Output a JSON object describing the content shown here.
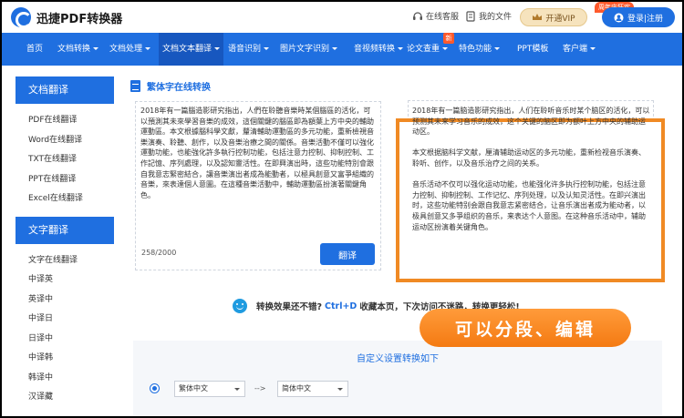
{
  "header": {
    "logo_text": "迅捷PDF转换器",
    "service_label": "在线客服",
    "files_label": "我的文件",
    "vip_label": "开通VIP",
    "vip_tag": "周年庆狂欢",
    "login_label": "登录|注册"
  },
  "nav": {
    "items": [
      "首页",
      "文档转换",
      "文档处理",
      "文档文本翻译",
      "语音识别",
      "图片文字识别",
      "音视频转换",
      "论文查重",
      "特色功能",
      "PPT模板",
      "客户端"
    ],
    "new_badge": "新"
  },
  "sidebar": {
    "section1_title": "文档翻译",
    "section1_items": [
      "PDF在线翻译",
      "Word在线翻译",
      "TXT在线翻译",
      "PPT在线翻译",
      "Excel在线翻译"
    ],
    "section2_title": "文字翻译",
    "section2_items": [
      "文字在线翻译",
      "中译英",
      "英译中",
      "中译日",
      "日译中",
      "中译韩",
      "韩译中",
      "汉译藏"
    ]
  },
  "main": {
    "title": "繁体字在线转换",
    "source_paragraphs": [
      "2018年有一篇腦造影研究指出，人們在聆聽音樂時某個腦區的活化，可以預測其未來學習音樂的成效，這個關鍵的腦區即為額葉上方中央的輔助運動區。本文根據腦科學文獻，釐清輔助運動區的多元功能，重新檢視音樂演奏、聆聽、創作，以及音樂治療之間的關係。音樂活動不僅可以強化運動功能，也能強化許多執行控制功能，包括注意力控制、抑制控制、工作記憶、序列處理，以及認知靈活性。在即興演出時，這些功能特別會跟自我意志緊密結合，讓音樂演出者成為能動者，以極具創意又富爭組織的音樂，來表達個人意圖。在這種音樂活動中，輔助運動區扮演著關鍵角色。"
    ],
    "counter": "258/2000",
    "translate_button": "翻译",
    "output_paragraphs": [
      "2018年有一篇脑造影研究指出，人们在聆听音乐时某个脑区的活化，可以预测其未来学习音乐的成效，这个关键的脑区即为额叶上方中央的辅助运动区。",
      "本文根据脑科学文献，厘清辅助运动区的多元功能，重新检视音乐演奏、聆听、创作，以及音乐治疗之间的关系。",
      "音乐活动不仅可以强化运动功能，也能强化许多执行控制功能，包括注意力控制、抑制控制、工作记忆、序列处理，以及认知灵活性。在即兴演出时，这些功能特别会跟自我意志紧密结合，让音乐演出者成为能动者，以极具创意又多爭组织的音乐，来表达个人意图。在这种音乐活动中，辅助运动区扮演着关键角色。"
    ],
    "tip_before": "转换效果还不错?",
    "tip_shortcut": "Ctrl+D",
    "tip_after": "收藏本页，下次访问不迷路，转换更轻松!",
    "overlay_text": "可以分段、编辑",
    "settings_title": "自定义设置转换如下",
    "from_select": "繁体中文",
    "arrow": "-->",
    "to_select": "简体中文"
  },
  "colors": {
    "brand": "#1f6fe0",
    "highlight": "#f08a24"
  }
}
